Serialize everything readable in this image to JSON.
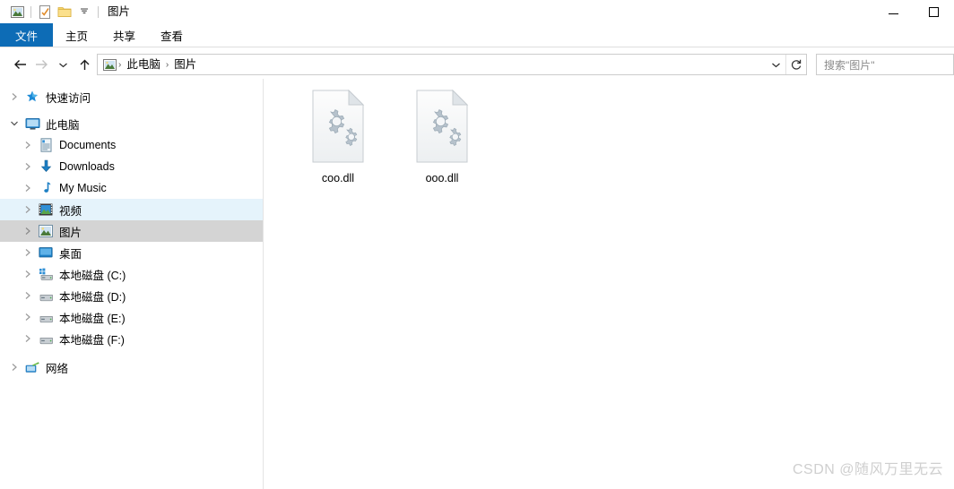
{
  "window": {
    "title": "图片",
    "quick_access_icons": [
      "picture-icon",
      "properties-check-icon",
      "folder-icon",
      "dropdown-chevron-icon"
    ],
    "controls": {
      "minimize": "minimize-icon",
      "maximize": "maximize-icon"
    }
  },
  "ribbon": {
    "tabs": [
      {
        "label": "文件",
        "active": true
      },
      {
        "label": "主页",
        "active": false
      },
      {
        "label": "共享",
        "active": false
      },
      {
        "label": "查看",
        "active": false
      }
    ]
  },
  "addressbar": {
    "back_icon": "back-arrow-icon",
    "forward_icon": "forward-arrow-icon",
    "recent_icon": "recent-locations-chevron-icon",
    "up_icon": "up-arrow-icon",
    "crumb_icon": "picture-folder-icon",
    "breadcrumbs": [
      "此电脑",
      "图片"
    ],
    "separator": "›",
    "dropdown_icon": "address-dropdown-icon",
    "refresh_icon": "refresh-icon"
  },
  "search": {
    "placeholder": "搜索\"图片\"",
    "icon": "search-icon"
  },
  "sidebar": {
    "items": [
      {
        "label": "快速访问",
        "icon": "star-icon",
        "level": 0,
        "expanded": false,
        "state": "normal"
      },
      {
        "label": "此电脑",
        "icon": "computer-icon",
        "level": 0,
        "expanded": true,
        "state": "normal"
      },
      {
        "label": "Documents",
        "icon": "documents-icon",
        "level": 1,
        "expanded": false,
        "state": "normal"
      },
      {
        "label": "Downloads",
        "icon": "downloads-icon",
        "level": 1,
        "expanded": false,
        "state": "normal"
      },
      {
        "label": "My Music",
        "icon": "music-icon",
        "level": 1,
        "expanded": false,
        "state": "normal"
      },
      {
        "label": "视频",
        "icon": "videos-icon",
        "level": 1,
        "expanded": false,
        "state": "hover"
      },
      {
        "label": "图片",
        "icon": "pictures-icon",
        "level": 1,
        "expanded": false,
        "state": "selected"
      },
      {
        "label": "桌面",
        "icon": "desktop-icon",
        "level": 1,
        "expanded": false,
        "state": "normal"
      },
      {
        "label": "本地磁盘 (C:)",
        "icon": "system-drive-icon",
        "level": 1,
        "expanded": false,
        "state": "normal"
      },
      {
        "label": "本地磁盘 (D:)",
        "icon": "drive-icon",
        "level": 1,
        "expanded": false,
        "state": "normal"
      },
      {
        "label": "本地磁盘 (E:)",
        "icon": "drive-icon",
        "level": 1,
        "expanded": false,
        "state": "normal"
      },
      {
        "label": "本地磁盘 (F:)",
        "icon": "drive-icon",
        "level": 1,
        "expanded": false,
        "state": "normal"
      },
      {
        "label": "网络",
        "icon": "network-icon",
        "level": 0,
        "expanded": false,
        "state": "normal"
      }
    ]
  },
  "files": {
    "items": [
      {
        "name": "coo.dll",
        "icon": "dll-gear-file-icon"
      },
      {
        "name": "ooo.dll",
        "icon": "dll-gear-file-icon"
      }
    ]
  },
  "watermark": {
    "text": "CSDN @随风万里无云"
  },
  "colors": {
    "accent": "#0d6cb6",
    "hover_row": "#e5f3fb",
    "selected_row": "#d4d4d4",
    "border": "#cccccc",
    "watermark": "#cfcfcf"
  }
}
